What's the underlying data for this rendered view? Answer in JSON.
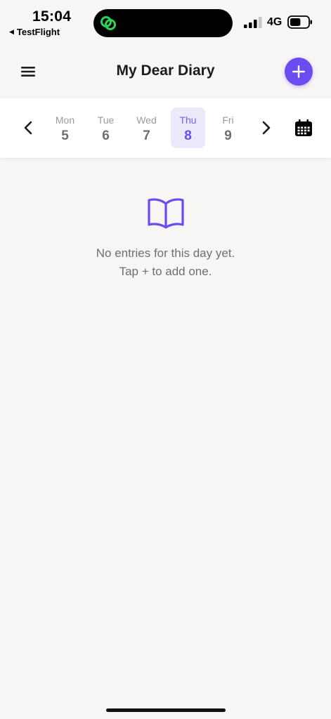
{
  "status_bar": {
    "time": "15:04",
    "back_app": "TestFlight",
    "back_icon": "left-triangle-icon",
    "network": "4G",
    "signal_bars": 3,
    "signal_bars_total": 4,
    "battery_level": 0.6,
    "island_icon": "link-icon",
    "island_icon_color": "#30d158"
  },
  "header": {
    "title": "My Dear Diary",
    "menu_icon": "hamburger-menu-icon",
    "add_icon": "plus-icon",
    "accent_color": "#6c4cf0"
  },
  "week_strip": {
    "prev_icon": "chevron-left-icon",
    "next_icon": "chevron-right-icon",
    "calendar_icon": "calendar-icon",
    "days": [
      {
        "dow": "Mon",
        "num": "5"
      },
      {
        "dow": "Tue",
        "num": "6"
      },
      {
        "dow": "Wed",
        "num": "7"
      },
      {
        "dow": "Thu",
        "num": "8",
        "selected": true
      },
      {
        "dow": "Fri",
        "num": "9"
      }
    ],
    "selected_bg": "#ece9fb"
  },
  "empty_state": {
    "icon": "open-book-icon",
    "line1": "No entries for this day yet.",
    "line2": "Tap + to add one."
  }
}
